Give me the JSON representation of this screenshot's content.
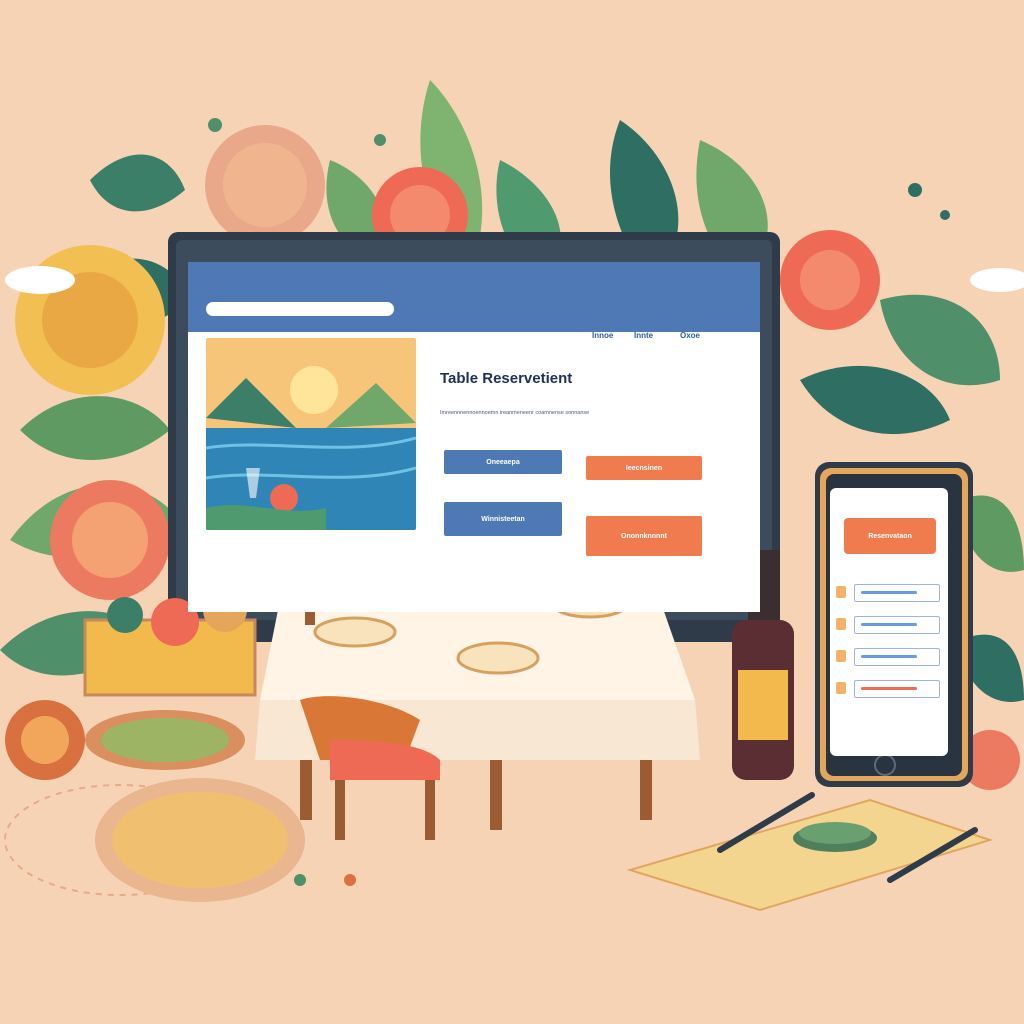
{
  "page": {
    "title": "Table Reservetient",
    "description": "Imreennnennoennoemn ireanmeneenr coamnense sonnanse",
    "nav_items": [
      "Innoe",
      "Innte",
      "Oxoe"
    ],
    "buttons": {
      "btn_1": "Oneeaepa",
      "btn_2": "Ieecnsinen",
      "btn_3": "Winnisteetan",
      "btn_4": "Ononnknnnnt"
    }
  },
  "phone": {
    "cta_label": "Resenvataon",
    "rows": 4
  },
  "colors": {
    "background": "#f7d3b6",
    "brand_blue": "#4e79b5",
    "accent_orange": "#f07b4f",
    "button_blue": "#4e79b5",
    "leaf_green": "#4f9a6e",
    "flower_red": "#ee6a55"
  },
  "icons": [
    "search-bar",
    "wine-glass-icon",
    "fork-icon",
    "knife-icon",
    "wine-bottle-icon",
    "cloud-icon"
  ]
}
